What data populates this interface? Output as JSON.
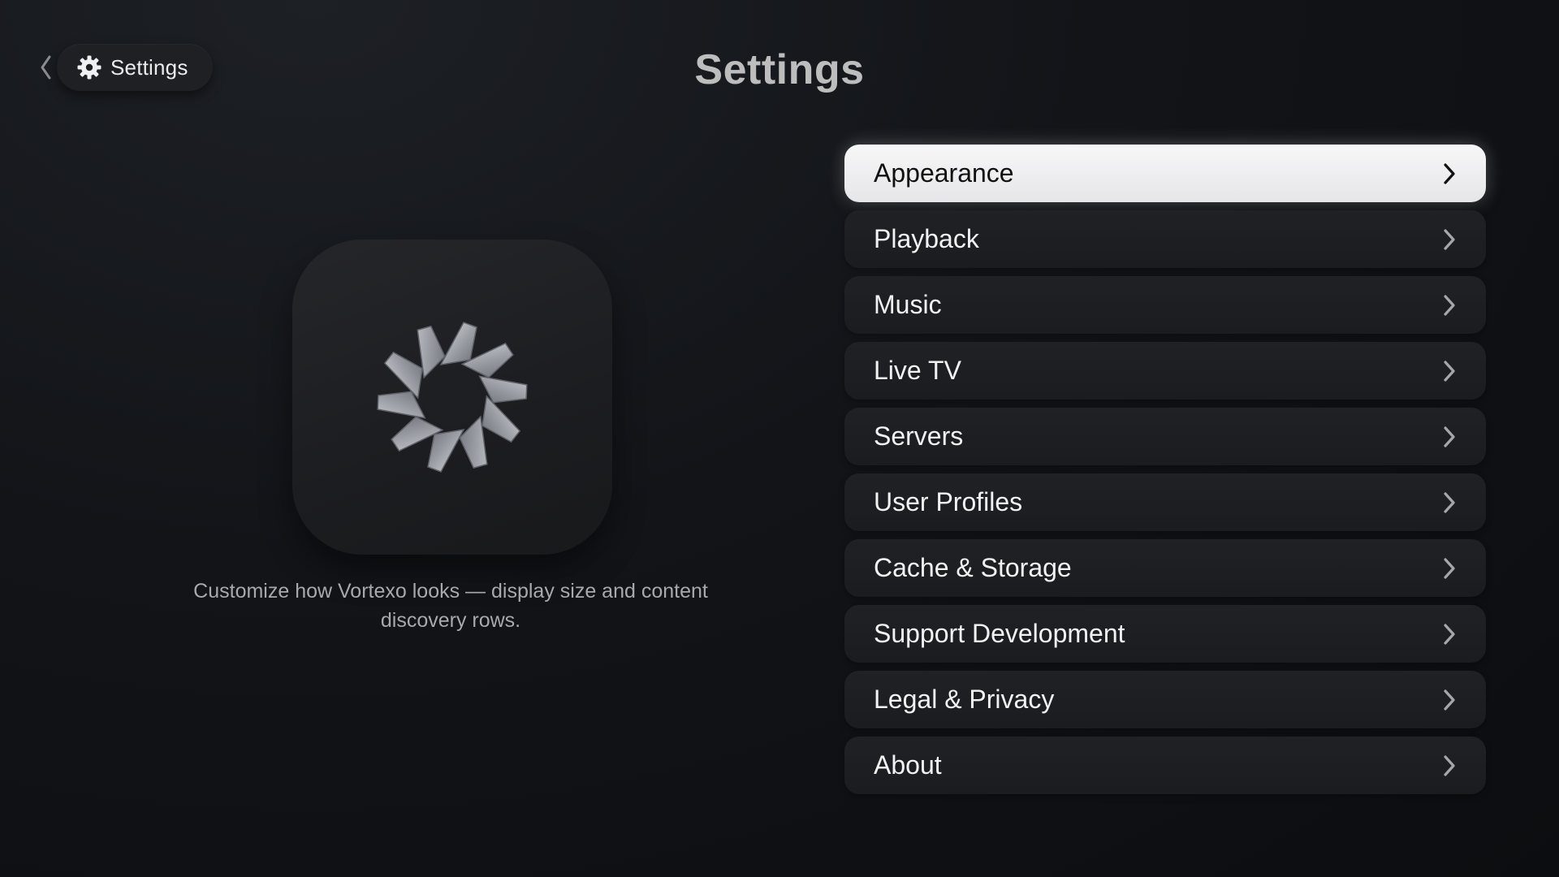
{
  "header": {
    "breadcrumb_label": "Settings",
    "title": "Settings"
  },
  "preview": {
    "description": "Customize how Vortexo looks — display size and content discovery rows."
  },
  "menu": {
    "items": [
      {
        "label": "Appearance",
        "focused": true
      },
      {
        "label": "Playback"
      },
      {
        "label": "Music"
      },
      {
        "label": "Live TV"
      },
      {
        "label": "Servers"
      },
      {
        "label": "User Profiles"
      },
      {
        "label": "Cache & Storage"
      },
      {
        "label": "Support Development"
      },
      {
        "label": "Legal & Privacy"
      },
      {
        "label": "About"
      }
    ]
  },
  "icons": {
    "back": "chevron-left-icon",
    "breadcrumb": "gear-icon",
    "app": "aperture-logo-icon",
    "row": "chevron-right-icon"
  },
  "colors": {
    "background": "#121418",
    "focused_row": "#eeeeef",
    "row": "#1d1f22",
    "title": "#bdbdbd",
    "description": "#a7a9ad"
  }
}
